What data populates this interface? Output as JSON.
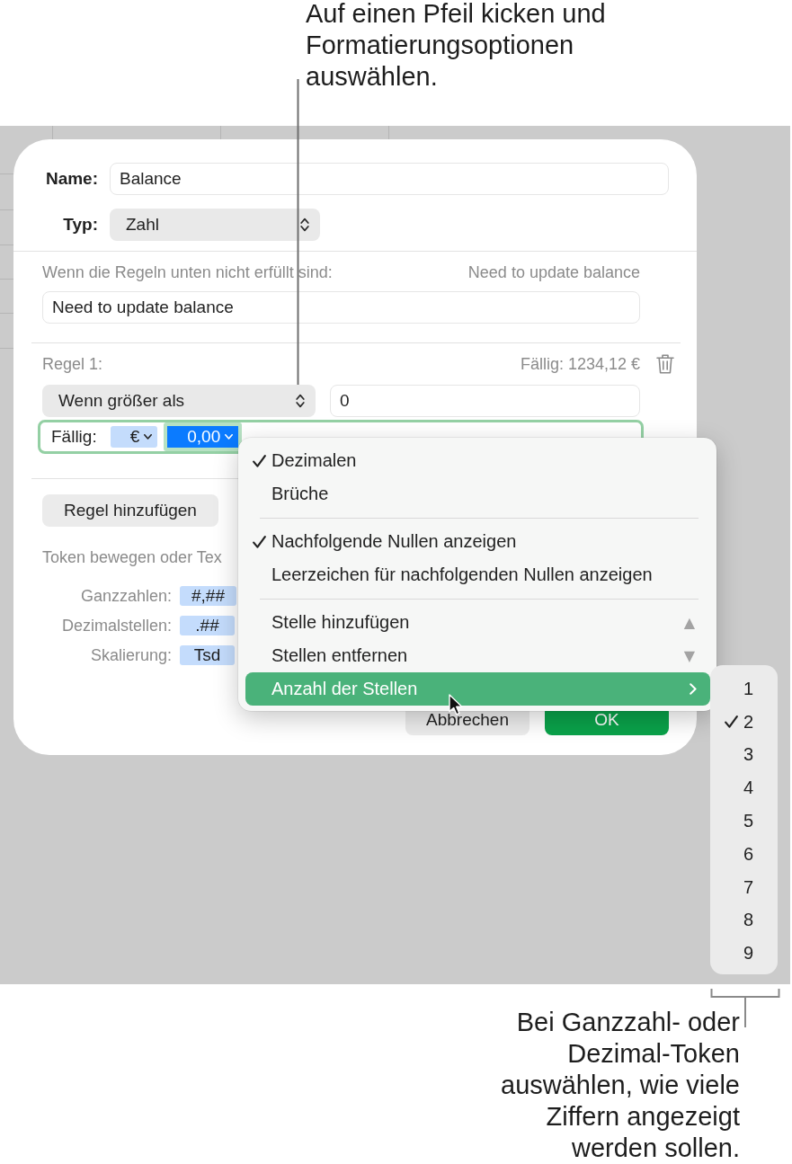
{
  "callouts": {
    "top": {
      "lines": [
        "Auf einen Pfeil kicken und",
        "Formatierungsoptionen",
        "auswählen."
      ]
    },
    "bottom": {
      "lines": [
        "Bei Ganzzahl- oder",
        "Dezimal-Token",
        "auswählen, wie viele",
        "Ziffern angezeigt",
        "werden sollen."
      ]
    }
  },
  "dialog": {
    "name_label": "Name:",
    "name_value": "Balance",
    "type_label": "Typ:",
    "type_value": "Zahl",
    "fallback_label": "Wenn die Regeln unten nicht erfüllt sind:",
    "fallback_preview": "Need to update balance",
    "fallback_value": "Need to update balance",
    "rules": [
      {
        "title": "Regel 1:",
        "preview": "Fällig: 1234,12 €",
        "condition": "Wenn größer als",
        "value": "0",
        "format": {
          "focused": true,
          "label": "Fällig:",
          "tokens": [
            {
              "label": "€",
              "selected": false
            },
            {
              "label": "0,00",
              "selected": true
            }
          ]
        }
      }
    ],
    "add_rule_button": "Regel hinzufügen",
    "hint": "Token bewegen oder Tex",
    "token_rows": [
      {
        "label": "Ganzzahlen:",
        "token": "#,##"
      },
      {
        "label": "Dezimalstellen:",
        "token": ".##"
      },
      {
        "label": "Skalierung:",
        "token": "Tsd"
      }
    ],
    "buttons": [
      {
        "kind": "secondary",
        "label": "Abbrechen"
      },
      {
        "kind": "primary",
        "label": "OK"
      }
    ]
  },
  "menu": {
    "groups": [
      [
        {
          "kind": "option",
          "label": "Dezimalen",
          "checked": true,
          "highlighted": false
        },
        {
          "kind": "option",
          "label": "Brüche",
          "checked": false,
          "highlighted": false
        }
      ],
      [
        {
          "kind": "option",
          "label": "Nachfolgende Nullen anzeigen",
          "checked": true,
          "highlighted": false
        },
        {
          "kind": "option",
          "label": "Leerzeichen für nachfolgenden Nullen anzeigen",
          "checked": false,
          "highlighted": false
        }
      ],
      [
        {
          "kind": "step",
          "label": "Stelle hinzufügen",
          "shortcut": "▲",
          "checked": false,
          "highlighted": false
        },
        {
          "kind": "step",
          "label": "Stellen entfernen",
          "shortcut": "▼",
          "checked": false,
          "highlighted": false
        },
        {
          "kind": "submenu",
          "label": "Anzahl der Stellen",
          "checked": false,
          "highlighted": true
        }
      ]
    ]
  },
  "submenu": {
    "items": [
      {
        "label": "1",
        "checked": false
      },
      {
        "label": "2",
        "checked": true
      },
      {
        "label": "3",
        "checked": false
      },
      {
        "label": "4",
        "checked": false
      },
      {
        "label": "5",
        "checked": false
      },
      {
        "label": "6",
        "checked": false
      },
      {
        "label": "7",
        "checked": false
      },
      {
        "label": "8",
        "checked": false
      },
      {
        "label": "9",
        "checked": false
      }
    ]
  }
}
